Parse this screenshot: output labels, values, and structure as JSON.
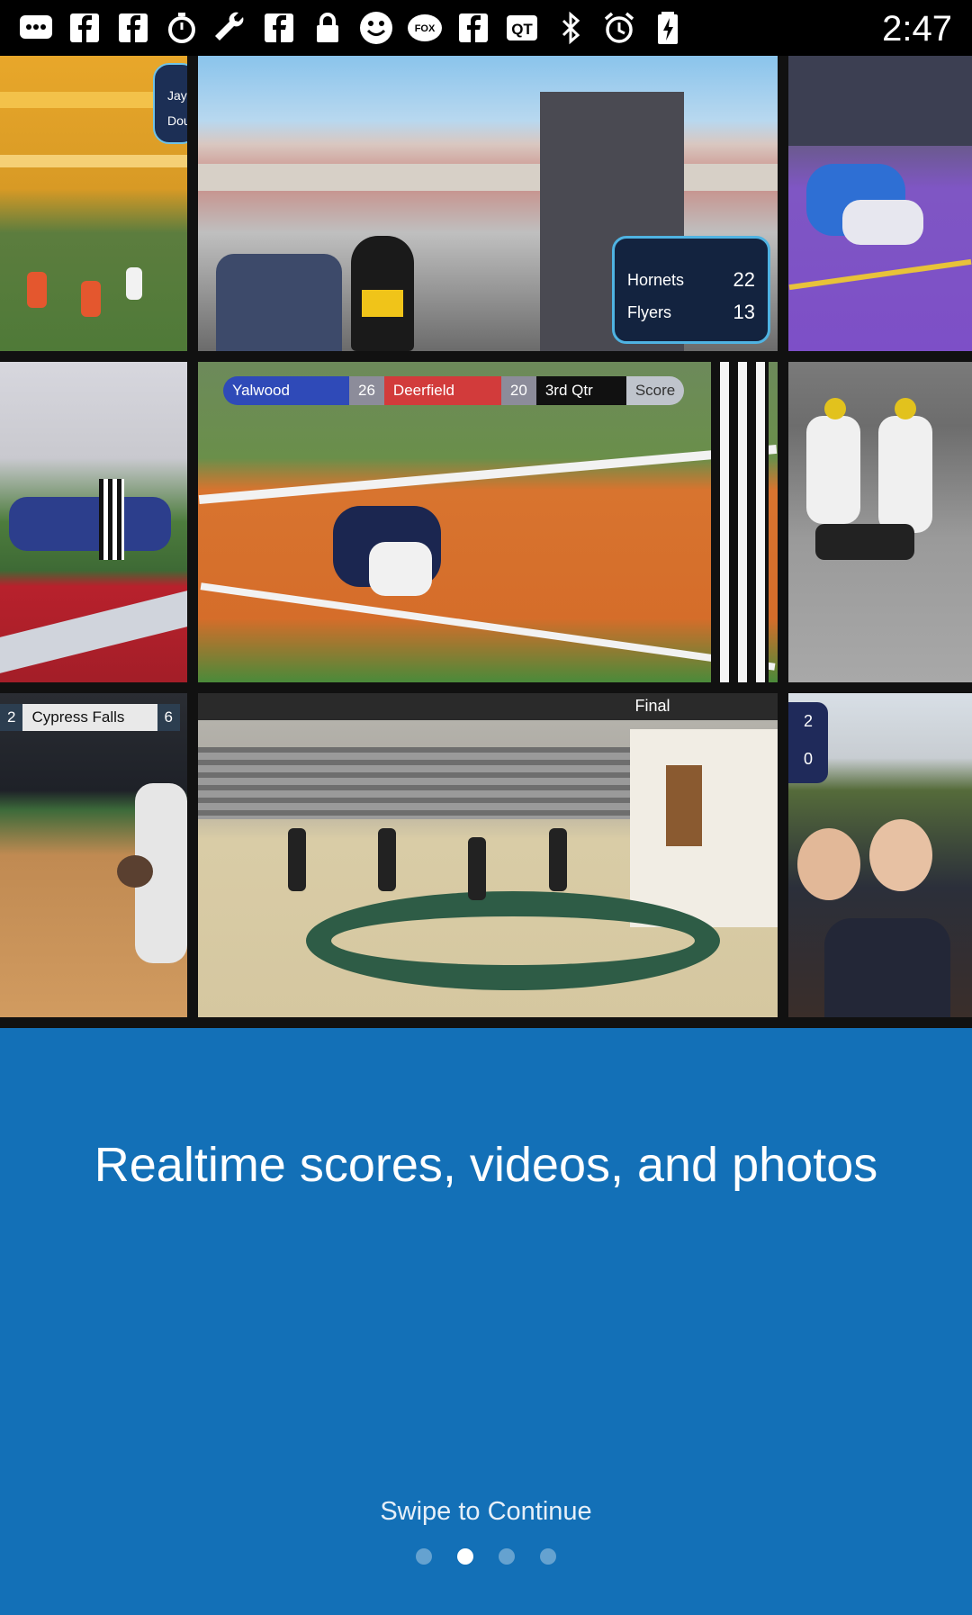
{
  "status_bar": {
    "time": "2:47",
    "icons": [
      "message-icon",
      "facebook-icon",
      "facebook-icon",
      "stopwatch-icon",
      "wrench-icon",
      "facebook-icon",
      "lock-icon",
      "smiley-icon",
      "fox-sports-icon",
      "facebook-icon",
      "qt-icon",
      "bluetooth-icon",
      "alarm-icon",
      "battery-charging-icon"
    ]
  },
  "collage": {
    "tiles": [
      {
        "name": "football-stadium-tile",
        "overlay": [
          "Jay",
          "Dou"
        ]
      },
      {
        "name": "stadium-mascot-tile",
        "overlay": [
          "Hornets",
          "22",
          "Flyers",
          "13"
        ]
      },
      {
        "name": "wrestling-tile",
        "overlay": []
      },
      {
        "name": "cheerleaders-tile",
        "overlay": []
      },
      {
        "name": "football-endzone-tile",
        "overlay": [
          "Yalwood",
          "26",
          "Deerfield",
          "20",
          "3rd Qtr",
          "Score"
        ]
      },
      {
        "name": "youth-football-tile",
        "overlay": []
      },
      {
        "name": "softball-tile",
        "overlay": [
          "2",
          "Cypress Falls",
          "6"
        ]
      },
      {
        "name": "volleyball-gym-tile",
        "overlay": [
          "Final"
        ]
      },
      {
        "name": "crowd-celebration-tile",
        "overlay": [
          "2",
          "0"
        ]
      }
    ]
  },
  "onboarding": {
    "headline": "Realtime scores, videos, and photos",
    "swipe_label": "Swipe to Continue",
    "page_count": 4,
    "active_page": 2
  },
  "colors": {
    "background": "#1370b7",
    "text": "#ffffff"
  }
}
